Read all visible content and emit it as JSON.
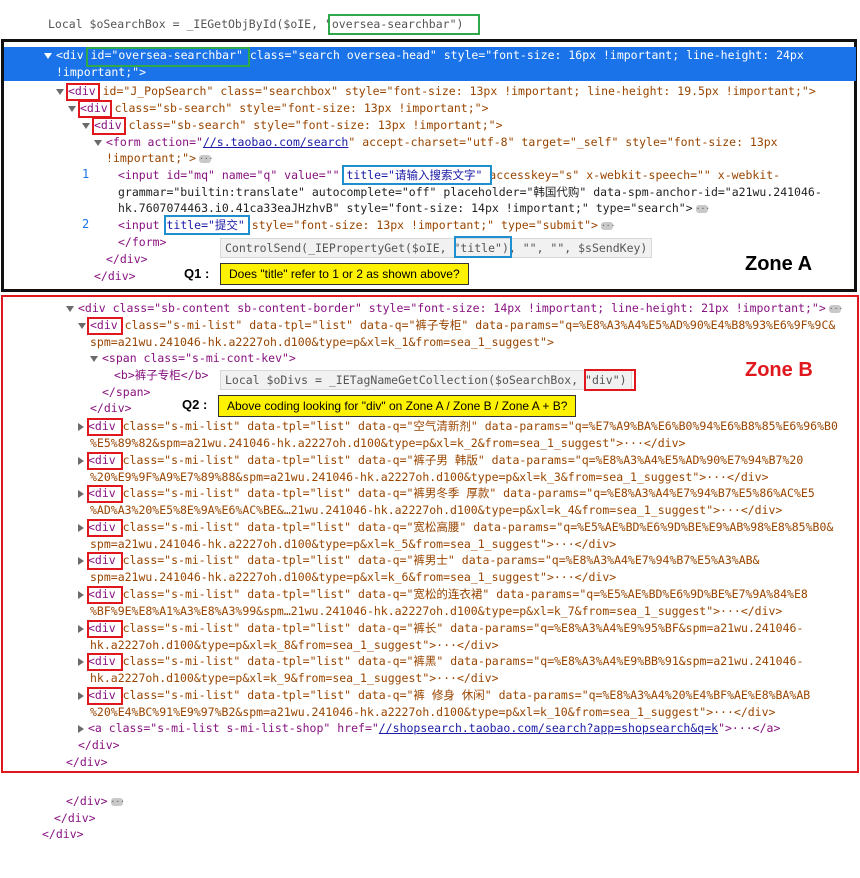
{
  "top_code": {
    "prefix": "Local $oSearchBox = _IEGetObjById($oIE, ",
    "arg": "\"oversea-searchbar\"",
    "suffix": ")"
  },
  "zone_a_label": "Zone A",
  "zone_b_label": "Zone B",
  "q1": {
    "label": "Q1 :",
    "text": "Does \"title\" refer to 1 or 2 as shown above?"
  },
  "q2": {
    "label": "Q2 :",
    "text": "Above coding looking for \"div\" on Zone A / Zone B / Zone A + B?"
  },
  "code_send": {
    "prefix": "ControlSend(_IEPropertyGet($oIE, ",
    "arg": "\"title\")",
    "suffix": ", \"\", \"\", $sSendKey)"
  },
  "code_divs": {
    "prefix": "Local $oDivs = _IETagNameGetCollection($oSearchBox, ",
    "arg": "\"div\")"
  },
  "markers": {
    "one": "1",
    "two": "2"
  },
  "ellipsis": "···",
  "lines": {
    "sel1": {
      "pre": "<div ",
      "id": "id=\"oversea-searchbar\"",
      "rest": " class=\"search oversea-head\" style=\"font-size: 16px !important; line-height: 24px"
    },
    "sel2": "!important;\">",
    "l3": {
      "open": "<div",
      "rest": " id=\"J_PopSearch\" class=\"searchbox\" style=\"font-size: 13px !important; line-height: 19.5px !important;\">"
    },
    "l4": {
      "open": "<div",
      "rest": " class=\"sb-search\" style=\"font-size: 13px !important;\">"
    },
    "l5": {
      "open": "<div",
      "rest": " class=\"sb-search\" style=\"font-size: 13px !important;\">"
    },
    "l6a": "<form action=\"",
    "l6url": "//s.taobao.com/search",
    "l6b": "\" accept-charset=\"utf-8\" target=\"_self\" style=\"font-size: 13px",
    "l7": "!important;\">",
    "l8a": "<input id=\"mq\" name=\"q\" value=\"\" ",
    "l8title": "title=\"请输入搜索文字\"",
    "l8b": " accesskey=\"s\" x-webkit-speech=\"\" x-webkit-",
    "l9": "grammar=\"builtin:translate\" autocomplete=\"off\" placeholder=\"韩国代购\" data-spm-anchor-id=\"a21wu.241046-",
    "l10": "hk.7607074463.i0.41ca33eaJHzhvB\" style=\"font-size: 14px !important;\" type=\"search\">",
    "l11a": "<input ",
    "l11title": "title=\"提交\"",
    "l11b": " style=\"font-size: 13px !important;\" type=\"submit\">",
    "l12": "</form>",
    "l13": "</div>",
    "l14": "</div>",
    "b1": "<div class=\"sb-content sb-content-border\" style=\"font-size: 14px !important; line-height: 21px !important;\">",
    "b2": {
      "open": "<div",
      "rest": " class=\"s-mi-list\" data-tpl=\"list\" data-q=\"裤子专柜\" data-params=\"q=%E8%A3%A4%E5%AD%90%E4%B8%93%E6%9F%9C&"
    },
    "b3": "spm=a21wu.241046-hk.a2227oh.d100&type=p&xl=k_1&from=sea_1_suggest\">",
    "b4": "<span class=\"s-mi-cont-kev\">",
    "b5": "<b>裤子专柜</b>",
    "b6": "</span>",
    "b7": "</div>",
    "rows": [
      {
        "l1": " class=\"s-mi-list\" data-tpl=\"list\" data-q=\"空气清新剂\" data-params=\"q=%E7%A9%BA%E6%B0%94%E6%B8%85%E6%96%B0",
        "l2": "%E5%89%82&spm=a21wu.241046-hk.a2227oh.d100&type=p&xl=k_2&from=sea_1_suggest\">···</div>"
      },
      {
        "l1": " class=\"s-mi-list\" data-tpl=\"list\" data-q=\"裤子男 韩版\" data-params=\"q=%E8%A3%A4%E5%AD%90%E7%94%B7%20",
        "l2": "%20%E9%9F%A9%E7%89%88&spm=a21wu.241046-hk.a2227oh.d100&type=p&xl=k_3&from=sea_1_suggest\">···</div>"
      },
      {
        "l1": " class=\"s-mi-list\" data-tpl=\"list\" data-q=\"裤男冬季 厚款\" data-params=\"q=%E8%A3%A4%E7%94%B7%E5%86%AC%E5",
        "l2": "%AD%A3%20%E5%8E%9A%E6%AC%BE&…21wu.241046-hk.a2227oh.d100&type=p&xl=k_4&from=sea_1_suggest\">···</div>"
      },
      {
        "l1": " class=\"s-mi-list\" data-tpl=\"list\" data-q=\"宽松高腰\" data-params=\"q=%E5%AE%BD%E6%9D%BE%E9%AB%98%E8%85%B0&",
        "l2": "spm=a21wu.241046-hk.a2227oh.d100&type=p&xl=k_5&from=sea_1_suggest\">···</div>"
      },
      {
        "l1": " class=\"s-mi-list\" data-tpl=\"list\" data-q=\"裤男士\" data-params=\"q=%E8%A3%A4%E7%94%B7%E5%A3%AB&",
        "l2": "spm=a21wu.241046-hk.a2227oh.d100&type=p&xl=k_6&from=sea_1_suggest\">···</div>"
      },
      {
        "l1": " class=\"s-mi-list\" data-tpl=\"list\" data-q=\"宽松的连衣裙\" data-params=\"q=%E5%AE%BD%E6%9D%BE%E7%9A%84%E8",
        "l2": "%BF%9E%E8%A1%A3%E8%A3%99&spm…21wu.241046-hk.a2227oh.d100&type=p&xl=k_7&from=sea_1_suggest\">···</div>"
      },
      {
        "l1": " class=\"s-mi-list\" data-tpl=\"list\" data-q=\"裤长\" data-params=\"q=%E8%A3%A4%E9%95%BF&spm=a21wu.241046-",
        "l2": "hk.a2227oh.d100&type=p&xl=k_8&from=sea_1_suggest\">···</div>"
      },
      {
        "l1": " class=\"s-mi-list\" data-tpl=\"list\" data-q=\"裤黑\" data-params=\"q=%E8%A3%A4%E9%BB%91&spm=a21wu.241046-",
        "l2": "hk.a2227oh.d100&type=p&xl=k_9&from=sea_1_suggest\">···</div>"
      },
      {
        "l1": " class=\"s-mi-list\" data-tpl=\"list\" data-q=\"裤 修身 休闲\" data-params=\"q=%E8%A3%A4%20%E4%BF%AE%E8%BA%AB",
        "l2": "%20%E4%BC%91%E9%97%B2&spm=a21wu.241046-hk.a2227oh.d100&type=p&xl=k_10&from=sea_1_suggest\">···</div>"
      }
    ],
    "row_div": "<div",
    "shop_a": "<a class=\"s-mi-list s-mi-list-shop\" href=\"",
    "shop_url": "//shopsearch.taobao.com/search?app=shopsearch&q=k",
    "shop_b": "\">···</a>",
    "b_end1": "</div>",
    "b_end2": "</div>",
    "end1": "</div>",
    "end2": "</div>",
    "end3": "</div>"
  }
}
